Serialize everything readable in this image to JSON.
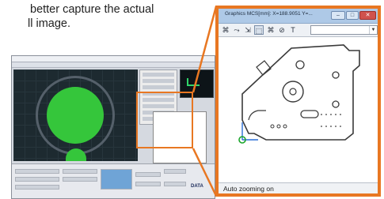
{
  "caption": {
    "line1": "better capture the actual",
    "line2": "ll image."
  },
  "window": {
    "title": "Graphics  MCS[mm]: X=188.9051 Y=...",
    "minimize_label": "–",
    "maximize_label": "□",
    "close_label": "✕",
    "status_text": "Auto zooming on",
    "zoom_select_value": ""
  },
  "background_app": {
    "data_logo": "DATA"
  },
  "toolbar": {
    "tools": [
      {
        "icon": "fit-view-icon",
        "glyph": "⌘"
      },
      {
        "icon": "pan-icon",
        "glyph": "⤳"
      },
      {
        "icon": "select-icon",
        "glyph": "⇲"
      },
      {
        "icon": "zoom-window-icon",
        "glyph": "⬚"
      },
      {
        "icon": "zoom-extents-icon",
        "glyph": "⌘"
      },
      {
        "icon": "measure-icon",
        "glyph": "⊘"
      },
      {
        "icon": "text-icon",
        "glyph": "T"
      }
    ]
  },
  "colors": {
    "accent_orange": "#e87722",
    "titlebar_blue": "#aec9e7",
    "origin_blue": "#2a6fd6",
    "origin_green": "#1aa52a",
    "part_outline": "#3a3a3a"
  }
}
